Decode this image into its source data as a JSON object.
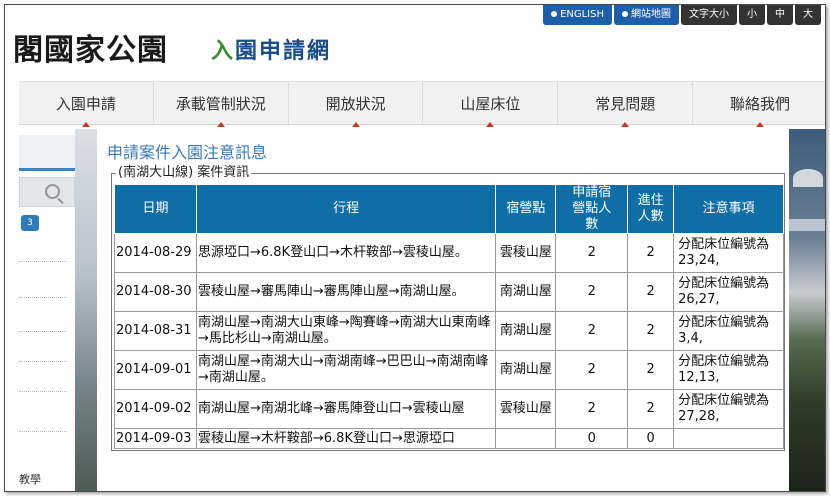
{
  "header": {
    "park_name": "閣國家公園",
    "site_name_a": "入",
    "site_name_b": "園申請網",
    "top_links": [
      "ENGLISH",
      "網站地圖",
      "文字大小",
      "小",
      "中",
      "大"
    ]
  },
  "nav": {
    "items": [
      "入園申請",
      "承載管制狀況",
      "開放狀況",
      "山屋床位",
      "常見問題",
      "聯絡我們"
    ]
  },
  "sidebar": {
    "badge": "3",
    "bottom_text": "教學"
  },
  "main": {
    "title": "申請案件入園注意訊息",
    "case_legend": "(南湖大山線) 案件資訊",
    "table": {
      "headers": [
        "日期",
        "行程",
        "宿營點",
        "申請宿營點人數",
        "進住人數",
        "注意事項"
      ],
      "rows": [
        {
          "date": "2014-08-29",
          "route": "思源埡口→6.8K登山口→木杆鞍部→雲稜山屋。",
          "camp": "雲稜山屋",
          "applied": "2",
          "stay": "2",
          "note": "分配床位編號為23,24,"
        },
        {
          "date": "2014-08-30",
          "route": "雲稜山屋→審馬陣山→審馬陣山屋→南湖山屋。",
          "camp": "南湖山屋",
          "applied": "2",
          "stay": "2",
          "note": "分配床位編號為26,27,"
        },
        {
          "date": "2014-08-31",
          "route": "南湖山屋→南湖大山東峰→陶賽峰→南湖大山東南峰→馬比杉山→南湖山屋。",
          "camp": "南湖山屋",
          "applied": "2",
          "stay": "2",
          "note": "分配床位編號為3,4,"
        },
        {
          "date": "2014-09-01",
          "route": "南湖山屋→南湖大山→南湖南峰→巴巴山→南湖南峰→南湖山屋。",
          "camp": "南湖山屋",
          "applied": "2",
          "stay": "2",
          "note": "分配床位編號為12,13,"
        },
        {
          "date": "2014-09-02",
          "route": "南湖山屋→南湖北峰→審馬陣登山口→雲稜山屋",
          "camp": "雲稜山屋",
          "applied": "2",
          "stay": "2",
          "note": "分配床位編號為27,28,"
        },
        {
          "date": "2014-09-03",
          "route": "雲稜山屋→木杆鞍部→6.8K登山口→思源埡口",
          "camp": "",
          "applied": "0",
          "stay": "0",
          "note": ""
        }
      ]
    }
  },
  "colors": {
    "header_blue": "#0f6ea5",
    "title_blue": "#3a7ab7",
    "nav_marker": "#c0392b"
  }
}
